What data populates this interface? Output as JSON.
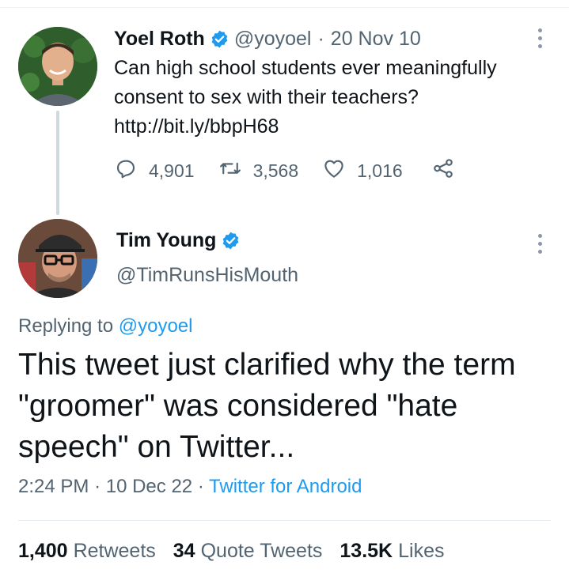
{
  "parent_tweet": {
    "author_name": "Yoel Roth",
    "handle": "@yoyoel",
    "separator": "·",
    "date": "20 Nov 10",
    "text": "Can high school students ever meaningfully\nconsent to sex with their teachers?\nhttp://bit.ly/bbpH68",
    "replies": "4,901",
    "retweets": "3,568",
    "likes": "1,016"
  },
  "reply_tweet": {
    "author_name": "Tim Young",
    "handle": "@TimRunsHisMouth",
    "replying_prefix": "Replying to ",
    "replying_to": "@yoyoel",
    "text": "This tweet just clarified why the term\n\"groomer\" was considered \"hate\nspeech\" on Twitter...",
    "time": "2:24 PM",
    "separator": "·",
    "date": "10 Dec 22",
    "source": "Twitter for Android"
  },
  "stats": {
    "retweets_count": "1,400",
    "retweets_label": "Retweets",
    "quotes_count": "34",
    "quotes_label": "Quote Tweets",
    "likes_count": "13.5K",
    "likes_label": "Likes"
  },
  "colors": {
    "accent": "#1d9bf0",
    "text_primary": "#0f1419",
    "text_secondary": "#536471"
  },
  "icons": [
    "verified-badge-icon",
    "more-options-icon",
    "reply-icon",
    "retweet-icon",
    "like-icon",
    "share-icon"
  ]
}
